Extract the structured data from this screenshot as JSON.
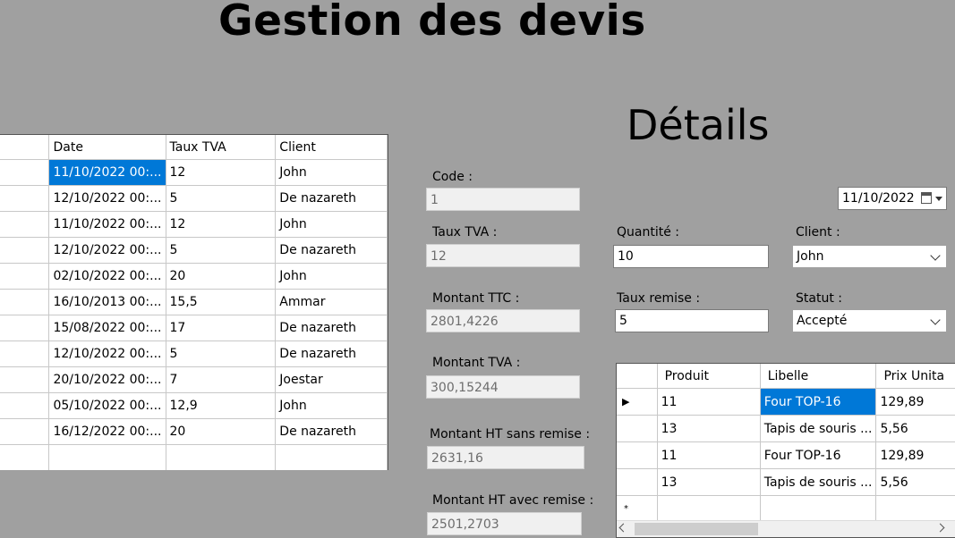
{
  "title": "Gestion des devis",
  "details_title": "Détails",
  "quotes_grid": {
    "columns": [
      "",
      "Date",
      "Taux TVA",
      "Client"
    ],
    "rows": [
      {
        "date": "11/10/2022 00:...",
        "tva": "12",
        "client": "John"
      },
      {
        "date": "12/10/2022 00:...",
        "tva": "5",
        "client": "De nazareth"
      },
      {
        "date": "11/10/2022 00:...",
        "tva": "12",
        "client": "John"
      },
      {
        "date": "12/10/2022 00:...",
        "tva": "5",
        "client": "De nazareth"
      },
      {
        "date": "02/10/2022 00:...",
        "tva": "20",
        "client": "John"
      },
      {
        "date": "16/10/2013 00:...",
        "tva": "15,5",
        "client": "Ammar"
      },
      {
        "date": "15/08/2022 00:...",
        "tva": "17",
        "client": "De nazareth"
      },
      {
        "date": "12/10/2022 00:...",
        "tva": "5",
        "client": "De nazareth"
      },
      {
        "date": "20/10/2022 00:...",
        "tva": "7",
        "client": "Joestar"
      },
      {
        "date": "05/10/2022 00:...",
        "tva": "12,9",
        "client": "John"
      },
      {
        "date": "16/12/2022 00:...",
        "tva": "20",
        "client": "De nazareth"
      }
    ]
  },
  "form": {
    "code_label": "Code :",
    "code_value": "1",
    "tva_label": "Taux TVA :",
    "tva_value": "12",
    "ttc_label": "Montant TTC :",
    "ttc_value": "2801,4226",
    "mtva_label": "Montant TVA :",
    "mtva_value": "300,15244",
    "ht_sans_label": "Montant HT sans remise :",
    "ht_sans_value": "2631,16",
    "ht_avec_label": "Montant HT avec remise :",
    "ht_avec_value": "2501,2703",
    "date_value": "11/10/2022",
    "quantite_label": "Quantité :",
    "quantite_value": "10",
    "client_label": "Client :",
    "client_value": "John",
    "remise_label": "Taux remise :",
    "remise_value": "5",
    "statut_label": "Statut :",
    "statut_value": "Accepté"
  },
  "lines_grid": {
    "columns": [
      "",
      "Produit",
      "Libelle",
      "Prix Unita"
    ],
    "rows": [
      {
        "produit": "11",
        "libelle": "Four TOP-16",
        "prix": "129,89"
      },
      {
        "produit": "13",
        "libelle": "Tapis de souris ...",
        "prix": "5,56"
      },
      {
        "produit": "11",
        "libelle": "Four TOP-16",
        "prix": "129,89"
      },
      {
        "produit": "13",
        "libelle": "Tapis de souris ...",
        "prix": "5,56"
      }
    ],
    "current_row_marker": "▶",
    "new_row_marker": "*"
  },
  "icons": {
    "calendar": "calendar-icon",
    "dropdown": "chevron-down-icon"
  },
  "colors": {
    "background": "#a0a0a0",
    "selection": "#0078d7"
  }
}
